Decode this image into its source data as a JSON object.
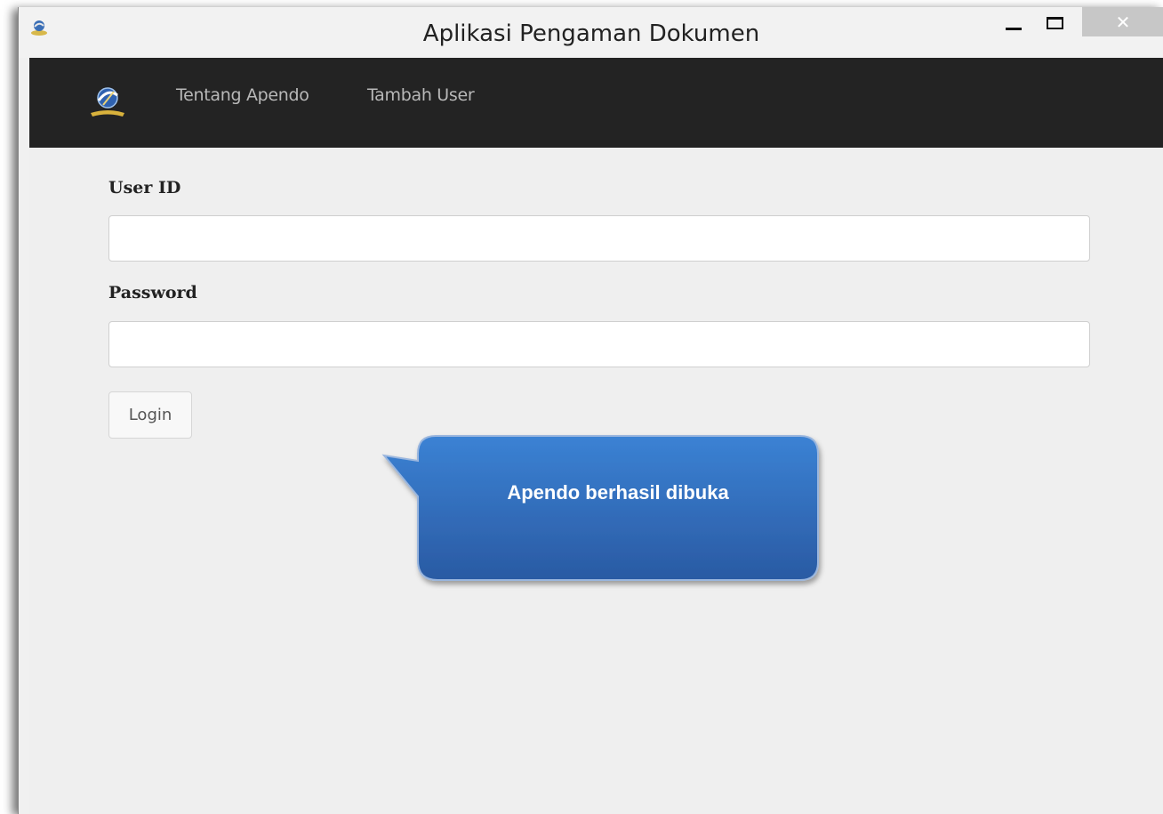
{
  "window": {
    "title": "Aplikasi Pengaman Dokumen",
    "close_glyph": "✕",
    "icons": {
      "app": "app-logo-icon",
      "minimize": "minimize-icon",
      "maximize": "maximize-icon",
      "close": "close-icon"
    }
  },
  "navbar": {
    "logo": "app-logo-icon",
    "items": [
      {
        "label": "Tentang Apendo"
      },
      {
        "label": "Tambah User"
      }
    ],
    "background": "#232323",
    "text_color": "#b8b8b8"
  },
  "form": {
    "user_id_label": "User ID",
    "user_id_value": "",
    "password_label": "Password",
    "password_value": "",
    "login_label": "Login"
  },
  "callout": {
    "text": "Apendo berhasil dibuka",
    "color_top": "#3a7fd0",
    "color_bottom": "#2a5da6"
  }
}
